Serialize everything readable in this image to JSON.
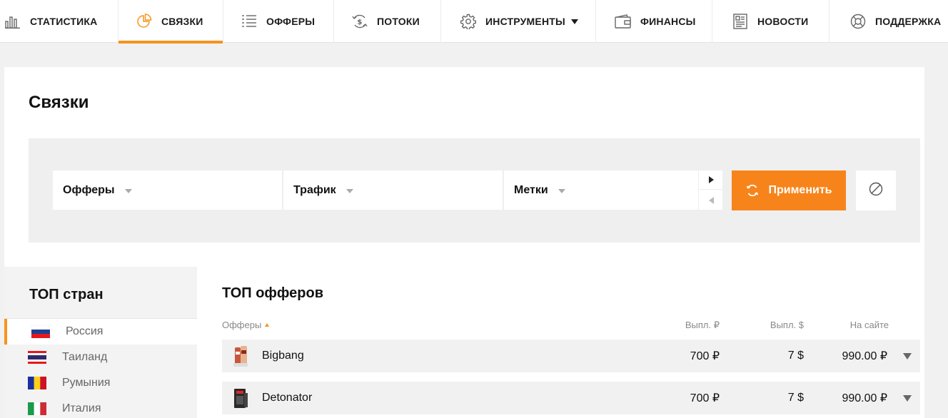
{
  "nav": {
    "items": [
      {
        "label": "СТАТИСТИКА",
        "icon": "bar-chart-icon"
      },
      {
        "label": "СВЯЗКИ",
        "icon": "pie-chart-icon"
      },
      {
        "label": "ОФФЕРЫ",
        "icon": "list-icon"
      },
      {
        "label": "ПОТОКИ",
        "icon": "dollar-cycle-icon"
      },
      {
        "label": "ИНСТРУМЕНТЫ",
        "icon": "gear-icon"
      },
      {
        "label": "ФИНАНСЫ",
        "icon": "wallet-icon"
      },
      {
        "label": "НОВОСТИ",
        "icon": "newspaper-icon"
      },
      {
        "label": "ПОДДЕРЖКА",
        "icon": "lifebuoy-icon"
      }
    ],
    "active": "СВЯЗКИ",
    "accent_color": "#f7931e"
  },
  "page": {
    "title": "Связки"
  },
  "filters": {
    "offers": "Офферы",
    "traffic": "Трафик",
    "tags": "Метки",
    "apply": "Применить",
    "apply_color": "#f7841b"
  },
  "countries": {
    "title": "ТОП стран",
    "items": [
      {
        "name": "Россия",
        "flag": "russia-flag"
      },
      {
        "name": "Таиланд",
        "flag": "thailand-flag"
      },
      {
        "name": "Румыния",
        "flag": "romania-flag"
      },
      {
        "name": "Италия",
        "flag": "italy-flag"
      }
    ]
  },
  "offers": {
    "title": "ТОП офферов",
    "columns": [
      "Офферы",
      "Выпл. ₽",
      "Выпл. $",
      "На сайте"
    ],
    "rows": [
      {
        "name": "Bigbang",
        "pay_rub": "700 ₽",
        "pay_usd": "7 $",
        "site_price": "990.00 ₽"
      },
      {
        "name": "Detonator",
        "pay_rub": "700 ₽",
        "pay_usd": "7 $",
        "site_price": "990.00 ₽"
      }
    ]
  }
}
